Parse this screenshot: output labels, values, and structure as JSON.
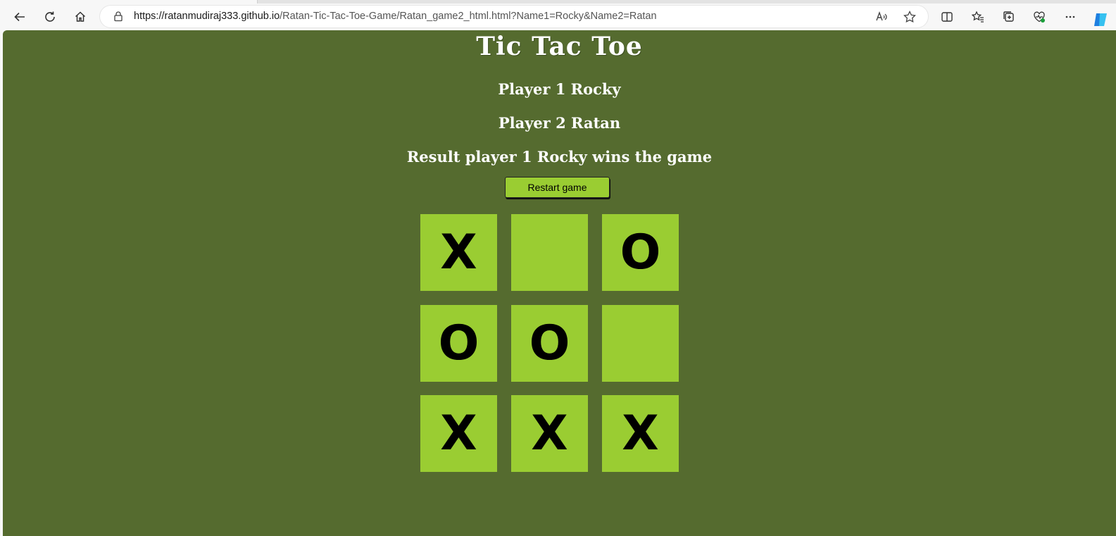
{
  "browser": {
    "url_host": "https://ratanmudiraj333.github.io",
    "url_path": "/Ratan-Tic-Tac-Toe-Game/Ratan_game2_html.html?Name1=Rocky&Name2=Ratan"
  },
  "game": {
    "title": "Tic Tac Toe",
    "player1": "Player 1 Rocky",
    "player2": "Player 2 Ratan",
    "result": "Result player 1 Rocky wins the game",
    "restart_label": "Restart game",
    "board": [
      "X",
      "",
      "O",
      "O",
      "O",
      "",
      "X",
      "X",
      "X"
    ]
  },
  "colors": {
    "background": "#556b2f",
    "cell": "#9acd32",
    "button": "#9acd32"
  }
}
